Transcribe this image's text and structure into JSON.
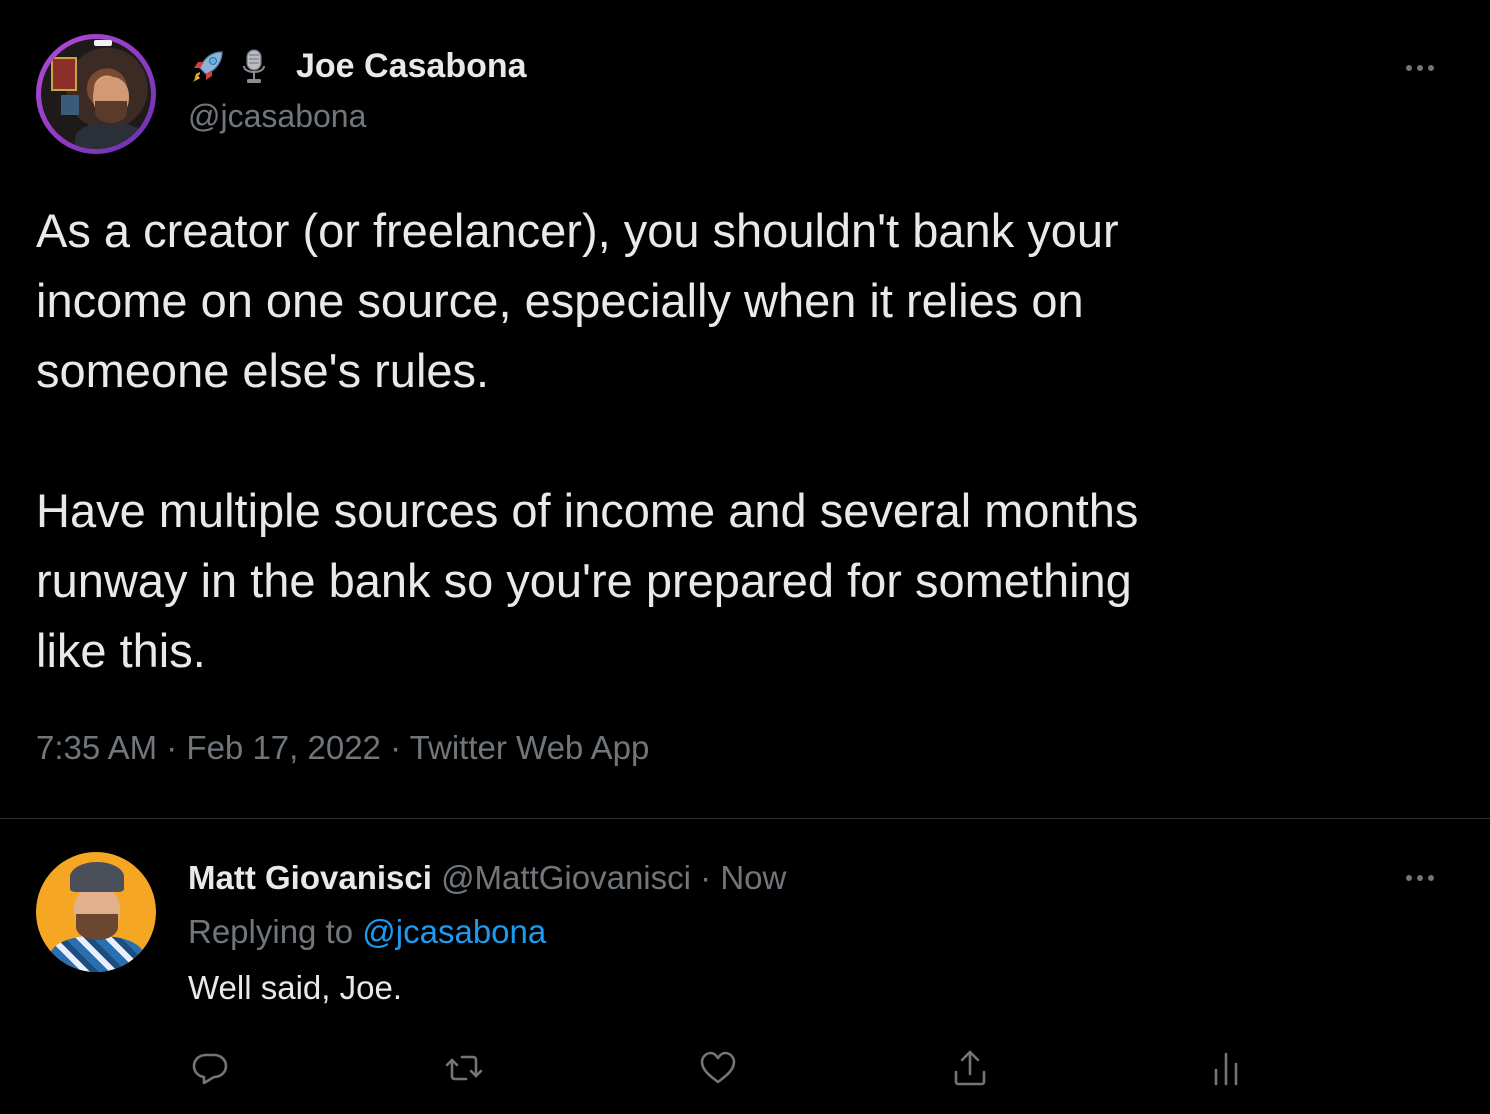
{
  "main_tweet": {
    "author": {
      "display_name": "Joe Casabona",
      "handle": "@jcasabona",
      "name_emojis": [
        "rocket-icon",
        "microphone-icon"
      ]
    },
    "paragraphs": [
      [
        "As a creator (or freelancer), you shouldn't bank your",
        "income on one source, especially when it relies on",
        "someone else's rules."
      ],
      [
        "Have multiple sources of income and several months",
        "runway in the bank so you're prepared for something",
        "like this."
      ]
    ],
    "time": "7:35 AM",
    "date": "Feb 17, 2022",
    "source": "Twitter Web App",
    "separator": "·"
  },
  "reply": {
    "author": {
      "display_name": "Matt Giovanisci",
      "handle": "@MattGiovanisci"
    },
    "separator": "·",
    "time": "Now",
    "replying_prefix": "Replying to",
    "replying_to": "@jcasabona",
    "text": "Well said, Joe.",
    "actions": [
      "reply-icon",
      "retweet-icon",
      "like-icon",
      "share-icon",
      "analytics-icon"
    ]
  },
  "colors": {
    "background": "#000000",
    "text_primary": "#e7e9ea",
    "text_secondary": "#71767b",
    "link": "#1d9bf0",
    "divider": "#2f3336",
    "avatar_ring": "#b34cd8",
    "reply_avatar_bg": "#f5a623"
  }
}
